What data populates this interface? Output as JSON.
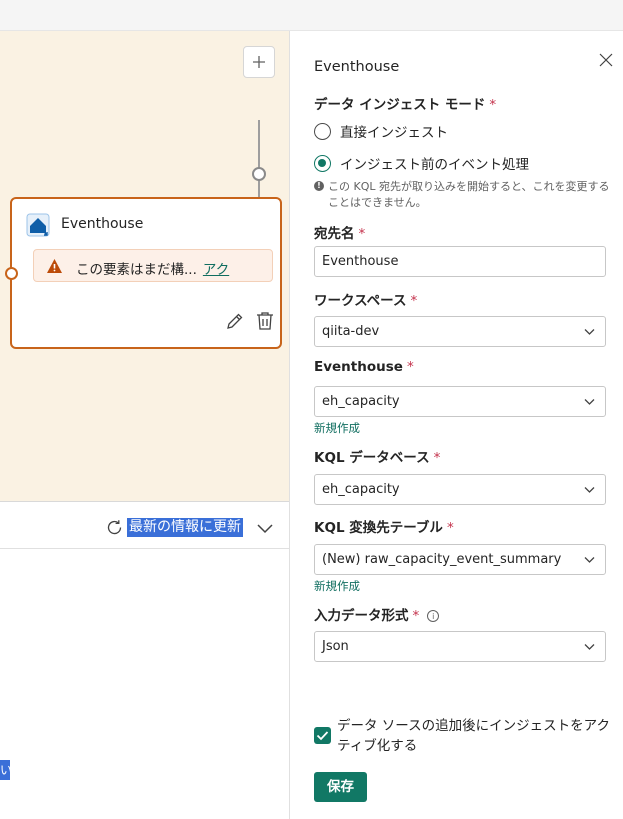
{
  "canvas": {
    "node": {
      "title": "Eventhouse",
      "warning_text": "この要素はまだ構...",
      "warning_link": "アク"
    }
  },
  "bottom_pane": {
    "refresh_label": "最新の情報に更新",
    "selected_fragment": "い"
  },
  "panel": {
    "title": "Eventhouse",
    "ingest_mode": {
      "label": "データ インジェスト モード",
      "required_mark": "*",
      "options": [
        {
          "label": "直接インジェスト",
          "checked": false
        },
        {
          "label": "インジェスト前のイベント処理",
          "checked": true
        }
      ],
      "note": "この KQL 宛先が取り込みを開始すると、これを変更することはできません。"
    },
    "destination_name": {
      "label": "宛先名",
      "required_mark": "*",
      "value": "Eventhouse"
    },
    "workspace": {
      "label": "ワークスペース",
      "required_mark": "*",
      "value": "qiita-dev"
    },
    "eventhouse": {
      "label": "Eventhouse",
      "required_mark": "*",
      "value": "eh_capacity",
      "create_link": "新規作成"
    },
    "kql_database": {
      "label": "KQL データベース",
      "required_mark": "*",
      "value": "eh_capacity"
    },
    "kql_table": {
      "label": "KQL 変換先テーブル",
      "required_mark": "*",
      "value": "(New) raw_capacity_event_summary",
      "create_link": "新規作成"
    },
    "input_format": {
      "label": "入力データ形式",
      "required_mark": "*",
      "value": "Json"
    },
    "activate_checkbox": {
      "label": "データ ソースの追加後にインジェストをアクティブ化する",
      "checked": true
    },
    "save_label": "保存"
  },
  "colors": {
    "accent": "#117865",
    "node_border": "#c8641a",
    "canvas_bg": "#faf2e3",
    "selection": "#3a6fd8"
  }
}
